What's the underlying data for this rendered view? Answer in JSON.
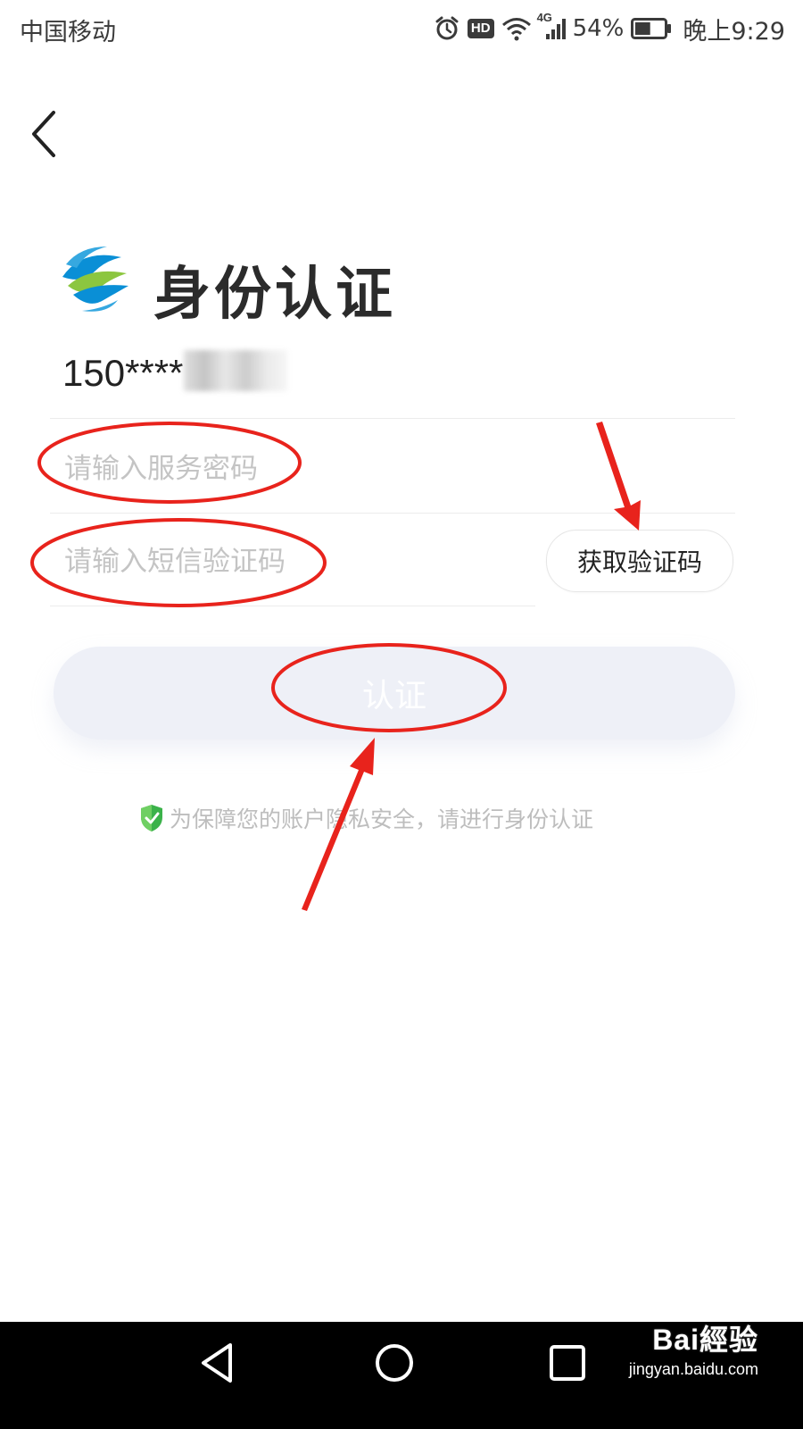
{
  "status_bar": {
    "carrier": "中国移动",
    "hd_label": "HD",
    "network_label": "4G",
    "battery_percent": "54%",
    "time": "晚上9:29",
    "icons": [
      "alarm-icon",
      "hd-icon",
      "wifi-icon",
      "signal-icon",
      "battery-icon"
    ],
    "battery_level": 0.54
  },
  "header": {
    "back_icon": "chevron-left-icon"
  },
  "page": {
    "title": "身份认证",
    "logo": "china-mobile-logo",
    "phone_masked": "150****"
  },
  "form": {
    "service_password_placeholder": "请输入服务密码",
    "sms_code_placeholder": "请输入短信验证码",
    "get_code_label": "获取验证码",
    "submit_label": "认证"
  },
  "notice": {
    "icon": "shield-check-icon",
    "text": "为保障您的账户隐私安全，请进行身份认证"
  },
  "navigation": {
    "buttons": [
      "back-triangle-icon",
      "home-circle-icon",
      "recents-square-icon"
    ]
  },
  "watermark": {
    "brand": "Bai經验",
    "url": "jingyan.baidu.com"
  },
  "colors": {
    "annotation_red": "#e8231c",
    "button_disabled_bg": "#eef0f7",
    "placeholder": "#c4c4c4",
    "shield_green": "#3bb24a",
    "logo_blue": "#0a8fd6",
    "logo_green": "#8cc63f"
  }
}
